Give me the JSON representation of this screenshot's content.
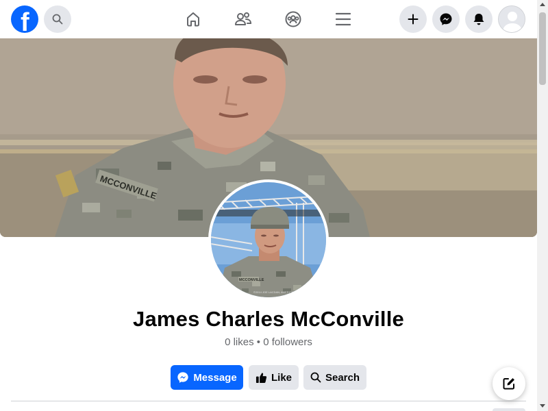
{
  "topbar": {
    "logo_icon": "facebook-logo-icon",
    "logo_letter": "f",
    "search_icon": "search-icon",
    "nav_icons": [
      "home-icon",
      "friends-icon",
      "groups-icon",
      "menu-icon"
    ],
    "right_icons": [
      "plus-icon",
      "messenger-icon",
      "bell-icon",
      "avatar-icon"
    ]
  },
  "profile": {
    "name": "James Charles McConville",
    "stats": "0 likes • 0 followers"
  },
  "actions": {
    "message_label": "Message",
    "like_label": "Like",
    "search_label": "Search"
  },
  "colors": {
    "brand": "#0866ff",
    "button_gray": "#e4e6eb",
    "text_primary": "#050505",
    "text_secondary": "#65676b"
  },
  "compose_icon": "compose-icon"
}
